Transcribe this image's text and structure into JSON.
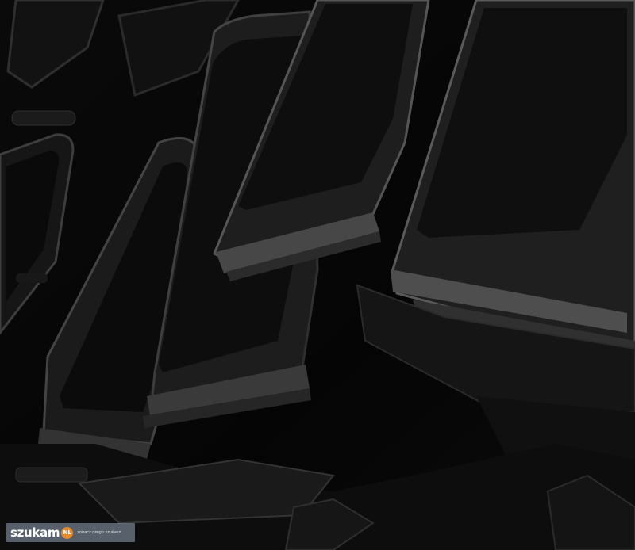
{
  "photo": {
    "subject": "stacked dark roof tiles",
    "palette": {
      "background": "#060606",
      "tile_face": "#1a1a1a",
      "tile_edge": "#5a5a5a",
      "tile_hollow": "#0c0c0c"
    }
  },
  "watermark": {
    "brand": "szukam",
    "badge": "NL",
    "tagline": "zobacz czego szukasz"
  }
}
